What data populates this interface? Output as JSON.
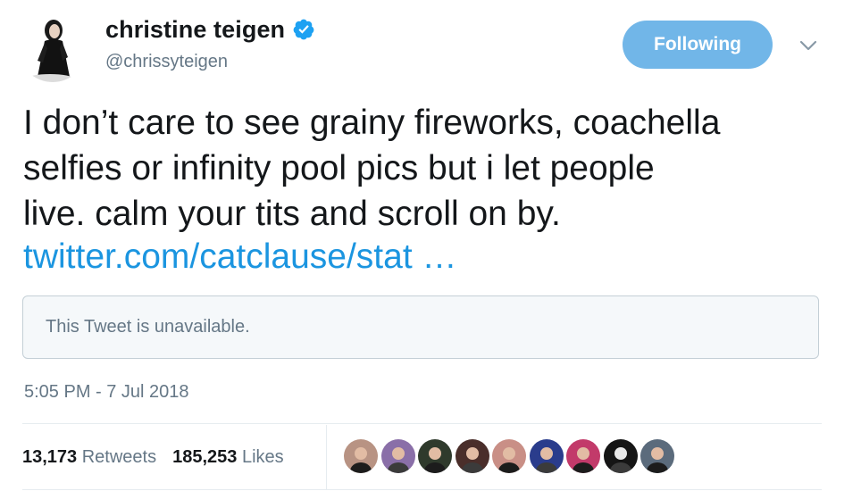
{
  "user": {
    "display_name": "christine teigen",
    "handle": "@chrissyteigen",
    "verified": true,
    "avatar_icon": "profile-photo-icon"
  },
  "follow_button": {
    "label": "Following",
    "color": "#71b6e8"
  },
  "menu": {
    "icon": "chevron-down-icon"
  },
  "tweet": {
    "text": "I don’t care to see grainy fireworks, coachella\nselfies or infinity pool pics but i let people\nlive. calm your tits and scroll on by.",
    "link_text": "twitter.com/catclause/stat …",
    "link_color": "#1b95e0"
  },
  "quoted_tweet": {
    "text": "This Tweet is unavailable."
  },
  "timestamp": "5:05 PM - 7 Jul 2018",
  "stats": {
    "retweets_count": "13,173",
    "retweets_label": "Retweets",
    "likes_count": "185,253",
    "likes_label": "Likes"
  },
  "liker_avatars": [
    {
      "name": "liker-avatar-1",
      "bg": "#b89383"
    },
    {
      "name": "liker-avatar-2",
      "bg": "#8a6fa8"
    },
    {
      "name": "liker-avatar-3",
      "bg": "#2f3a2c"
    },
    {
      "name": "liker-avatar-4",
      "bg": "#4a2e2a"
    },
    {
      "name": "liker-avatar-5",
      "bg": "#c98f86"
    },
    {
      "name": "liker-avatar-6",
      "bg": "#2a3c8c"
    },
    {
      "name": "liker-avatar-7",
      "bg": "#c23a6a"
    },
    {
      "name": "liker-avatar-8",
      "bg": "#151515"
    },
    {
      "name": "liker-avatar-9",
      "bg": "#5b6b7c"
    }
  ],
  "colors": {
    "text_primary": "#14171a",
    "text_secondary": "#657786",
    "border": "#e6ecf0",
    "verified_badge": "#1da1f2"
  }
}
